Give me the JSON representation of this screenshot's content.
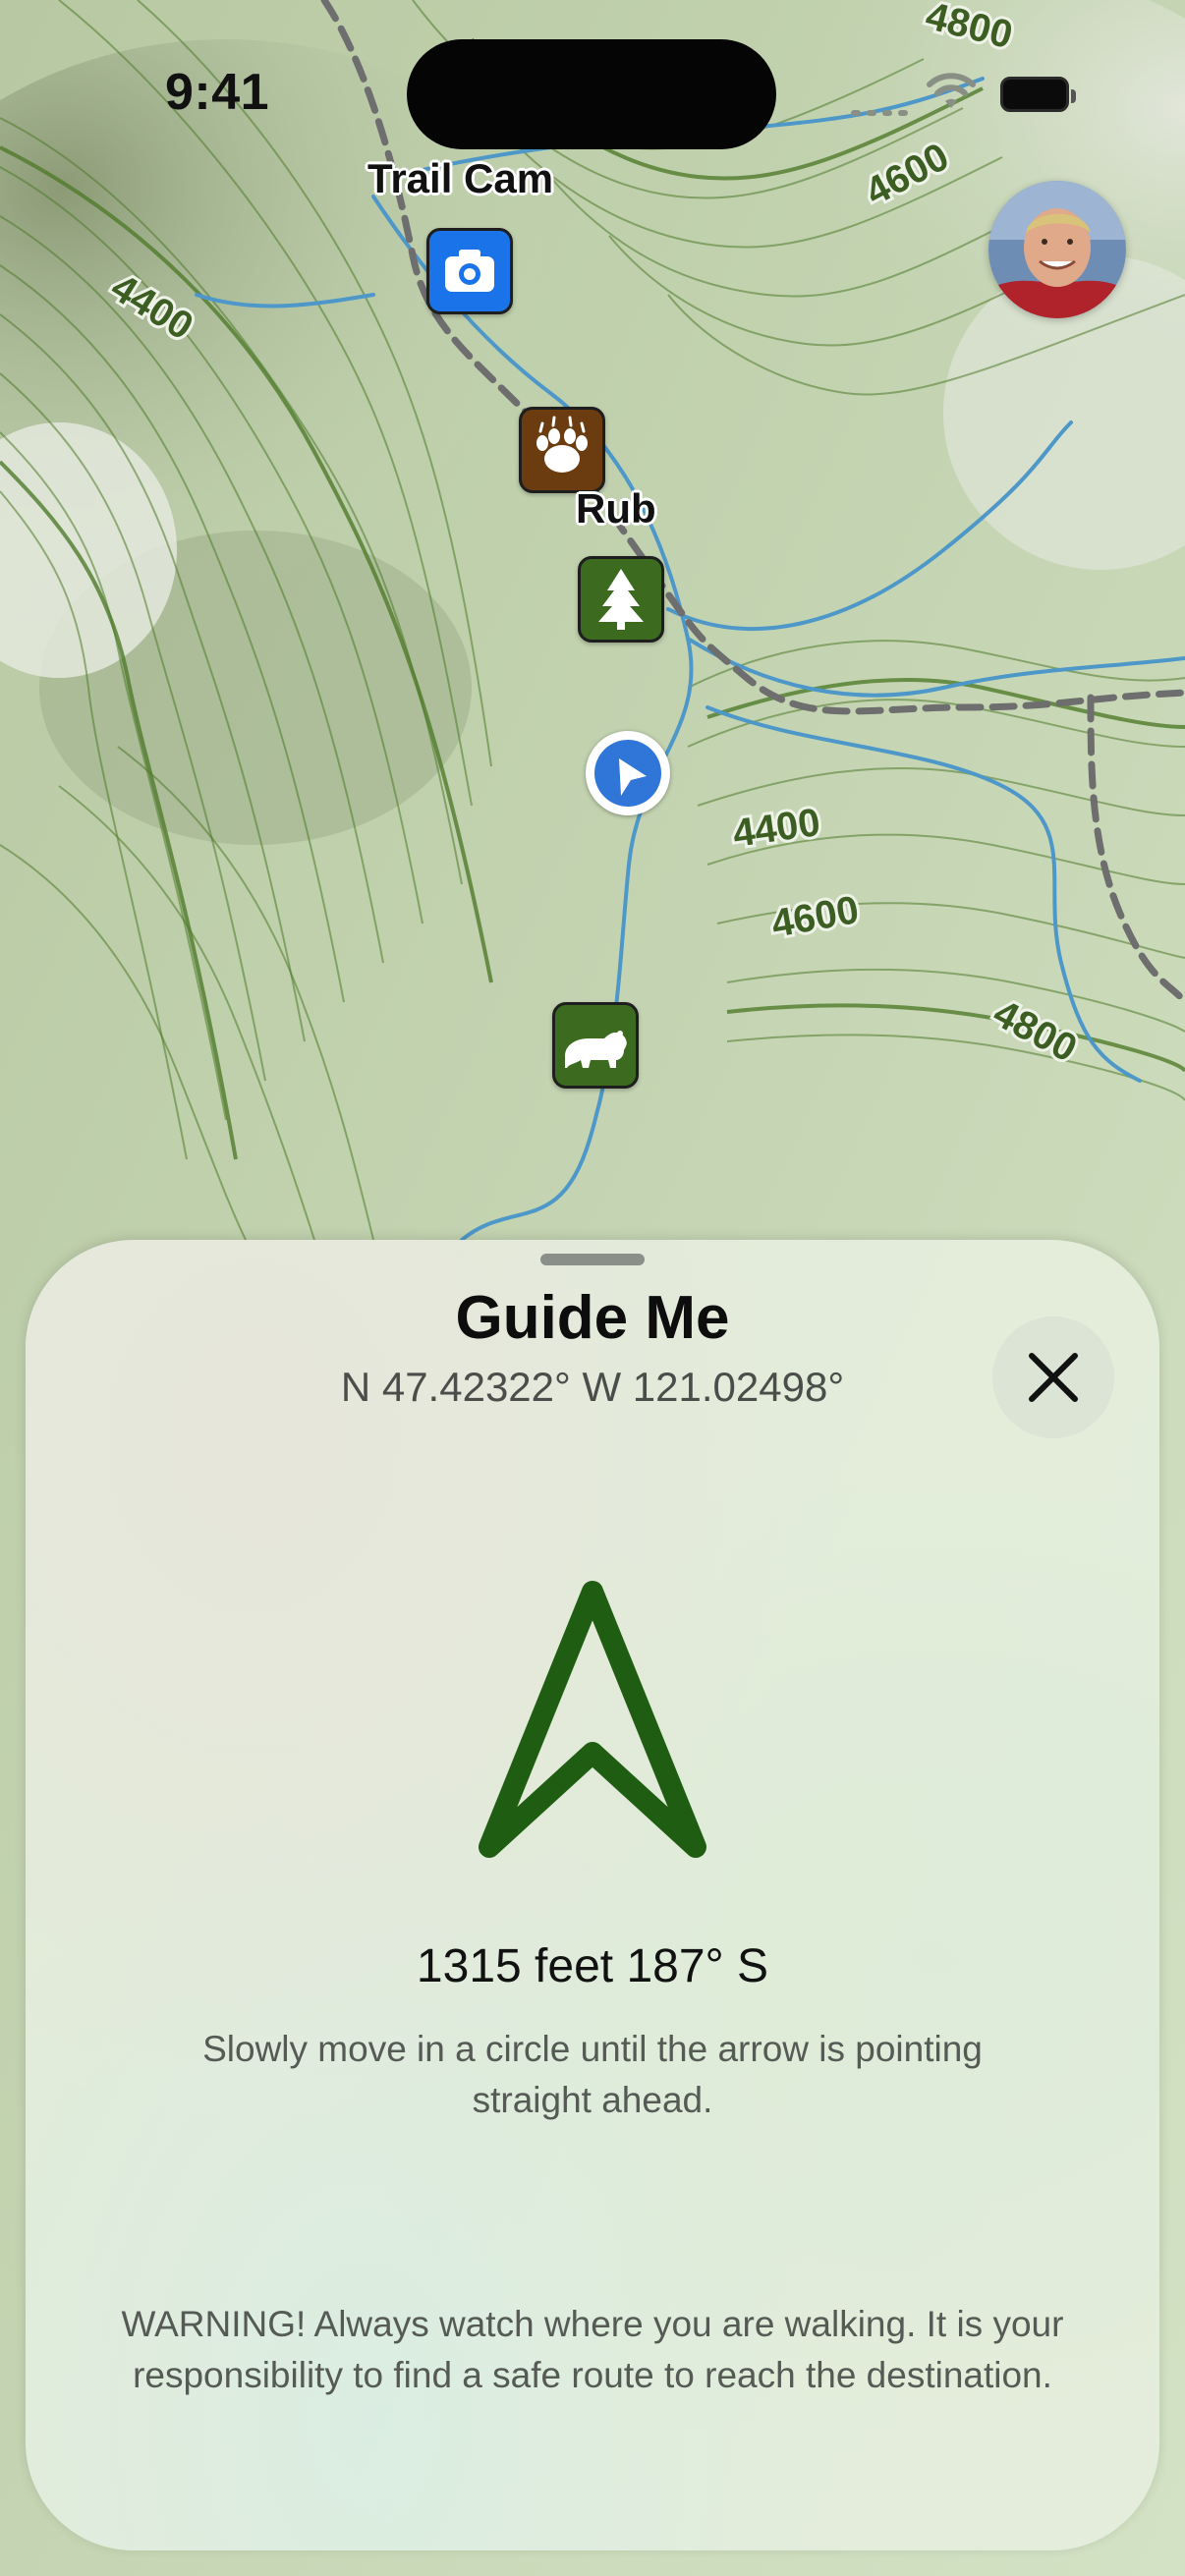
{
  "status_bar": {
    "time": "9:41"
  },
  "map": {
    "contour_labels": [
      "4400",
      "4600",
      "4400",
      "4600",
      "4800",
      "4800"
    ],
    "markers": [
      {
        "icon": "camera-icon",
        "label": "Trail Cam",
        "color": "#1a73e8"
      },
      {
        "icon": "bear-paw-icon",
        "label": "Rub",
        "color": "#6b3c10"
      },
      {
        "icon": "pine-tree-icon",
        "label": "",
        "color": "#3c6b1f"
      },
      {
        "icon": "bear-icon",
        "label": "",
        "color": "#3c6b1f"
      }
    ],
    "current_location_icon": "location-arrow-icon"
  },
  "guide_sheet": {
    "title": "Guide Me",
    "coordinates": "N 47.42322° W 121.02498°",
    "close_icon": "close-icon",
    "direction_arrow_icon": "navigation-arrow-icon",
    "arrow_color": "#1f5e12",
    "distance_bearing": "1315 feet 187° S",
    "instruction": "Slowly move in a circle until the arrow is pointing straight ahead.",
    "warning": "WARNING! Always watch where you are walking. It is your responsibility to find a safe route to reach the destination."
  }
}
